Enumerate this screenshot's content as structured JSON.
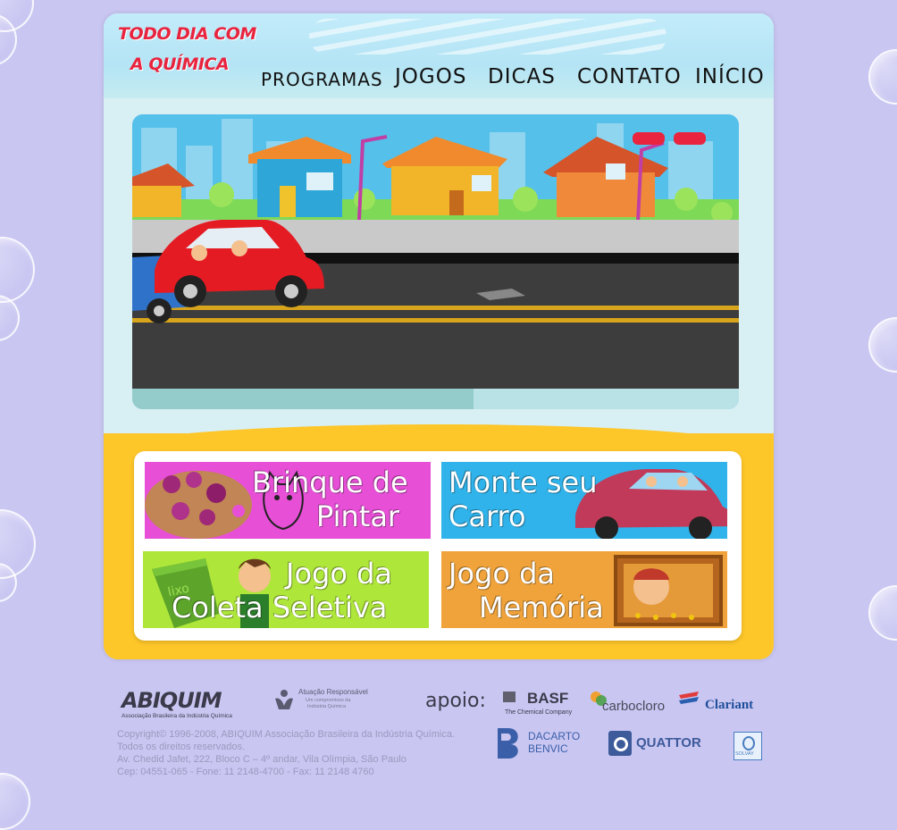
{
  "colors": {
    "page_background": "#c9c6f2",
    "logo_red": "#e8243f",
    "bottom_yellow": "#fdc629",
    "tile_pink": "#e64fd6",
    "tile_blue": "#2fb3ea",
    "tile_green": "#aee63a",
    "tile_orange": "#f0a33a"
  },
  "header": {
    "logo_line1": "TODO DIA COM",
    "logo_line2": "A QUÍMICA",
    "nav": [
      "PROGRAMAS",
      "JOGOS",
      "DICAS",
      "CONTATO",
      "INÍCIO"
    ]
  },
  "stage": {
    "scene": "cartoon-street-with-cars-and-houses"
  },
  "games": [
    {
      "line1": "Brinque de",
      "line1_small": "de",
      "line2": "Pintar",
      "icon": "paint-palette-icon",
      "color": "#e64fd6"
    },
    {
      "line1": "Monte seu",
      "line2": "Carro",
      "icon": "car-icon",
      "color": "#2fb3ea"
    },
    {
      "line1": "Jogo da",
      "line2": "Coleta Seletiva",
      "icon": "recycle-bin-icon",
      "bin_label": "lixo",
      "color": "#aee63a"
    },
    {
      "line1": "Jogo da",
      "line2": "Memória",
      "icon": "memory-card-icon",
      "color": "#f0a33a"
    }
  ],
  "footer": {
    "abiquim_logo": "ABIQUIM",
    "abiquim_sub": "Associação Brasileira da Indústria Química",
    "atuacao_title": "Atuação Responsável",
    "atuacao_sub1": "Um compromisso da",
    "atuacao_sub2": "Indústria Química",
    "support_label": "apoio:",
    "sponsors": {
      "basf": "BASF",
      "basf_sub": "The Chemical Company",
      "carbocloro": "carbocloro",
      "clariant": "Clariant",
      "dacarto1": "DACARTO",
      "dacarto2": "BENVIC",
      "quattor": "QUATTOR",
      "solvay": "SOLVAY"
    },
    "copyright": "Copyright© 1996-2008, ABIQUIM Associação Brasileira da Indústria Química.",
    "rights": "Todos os direitos reservados.",
    "address": "Av. Chedid Jafet, 222, Bloco C – 4º andar, Vila Olímpia, São Paulo",
    "phones": "Cep: 04551-065 - Fone: 11 2148-4700 - Fax: 11 2148 4760"
  }
}
